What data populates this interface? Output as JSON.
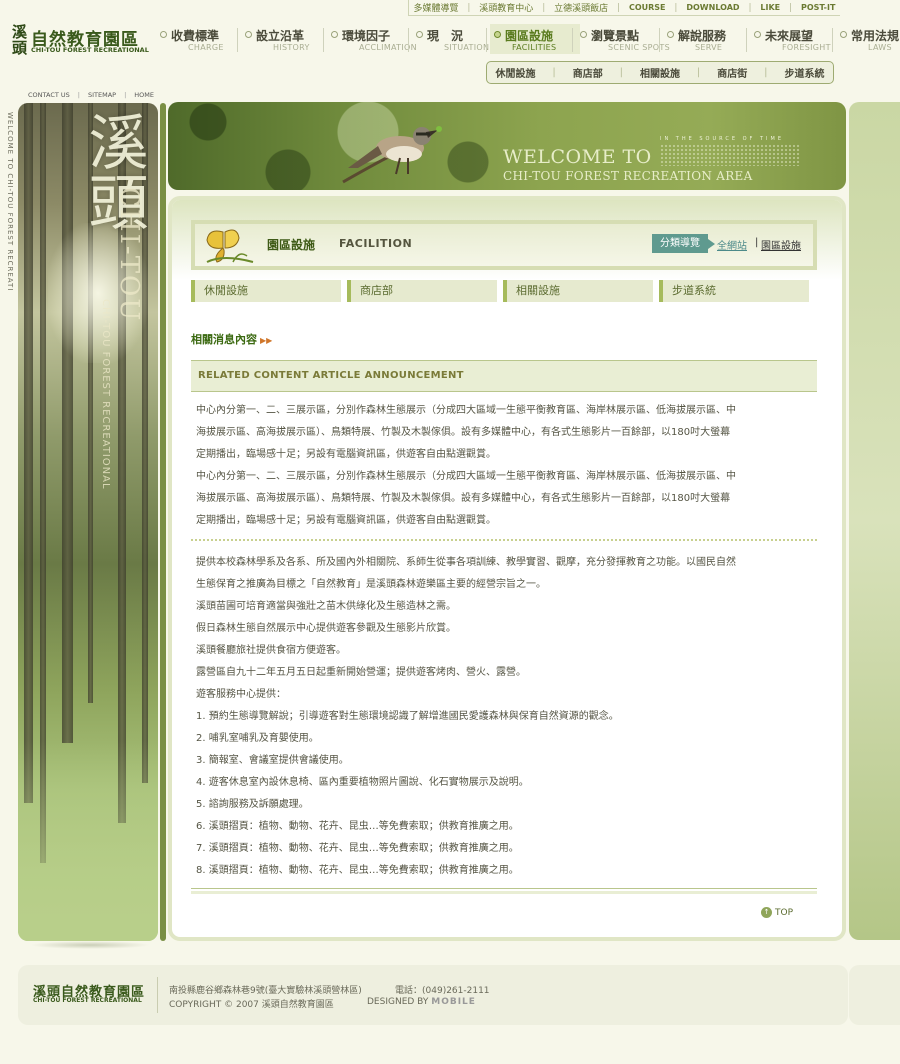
{
  "topbar": {
    "links": [
      "多媒體導覽",
      "溪頭教育中心",
      "立德溪頭飯店",
      "COURSE",
      "DOWNLOAD",
      "LIKE",
      "POST-IT"
    ]
  },
  "logo": {
    "vertical": "溪頭",
    "name": "自然教育園區",
    "sub": "CHI-TOU FOREST RECREATIONAL"
  },
  "nav": [
    {
      "zh": "收費標準",
      "en": "CHARGE"
    },
    {
      "zh": "設立沿革",
      "en": "HISTORY"
    },
    {
      "zh": "環境因子",
      "en": "ACCLIMATION"
    },
    {
      "zh": "現　況",
      "en": "SITUATION"
    },
    {
      "zh": "園區設施",
      "en": "FACILITIES"
    },
    {
      "zh": "瀏覽景點",
      "en": "SCENIC SPOTS"
    },
    {
      "zh": "解說服務",
      "en": "SERVE"
    },
    {
      "zh": "未來展望",
      "en": "FORESIGHT"
    },
    {
      "zh": "常用法規",
      "en": "LAWS"
    }
  ],
  "subnav": [
    "休閒設施",
    "商店部",
    "相關設施",
    "商店街",
    "步道系統"
  ],
  "small_links": [
    "CONTACT US",
    "SITEMAP",
    "HOME"
  ],
  "vertical_welcome": "WELCOME TO CHI-TOU FOREST RECREATI",
  "left_panel": {
    "big_text": "溪頭",
    "vertical_en": "CHI-TOU",
    "vertical_en2": "CHI-TOU FOREST RECREATIONAL"
  },
  "banner": {
    "welcome_line1": "WELCOME TO",
    "welcome_line2": "CHI-TOU FOREST RECREATION AREA",
    "tiny": "IN THE SOURCE OF TIME"
  },
  "crumb": {
    "title_zh": "園區設施",
    "title_en": "FACILITION",
    "pill": "分類導覽",
    "link_all": "全網站",
    "link_current": "園區設施"
  },
  "tabs": [
    "休閒設施",
    "商店部",
    "相關設施",
    "步道系統"
  ],
  "section_title": "相關消息內容",
  "announcement": "RELATED CONTENT ARTICLE ANNOUNCEMENT",
  "paragraph1": [
    "中心內分第一、二、三展示區，分別作森林生態展示（分成四大區域一生態平衡教育區、海岸林展示區、低海拔展示區、中",
    "海拔展示區、高海拔展示區）、鳥類特展、竹製及木製傢俱。設有多媒體中心，有各式生態影片一百餘部，以180吋大螢幕",
    "定期播出，臨場感十足；另設有電腦資訊區，供遊客自由點選觀賞。",
    "中心內分第一、二、三展示區，分別作森林生態展示（分成四大區域一生態平衡教育區、海岸林展示區、低海拔展示區、中",
    "海拔展示區、高海拔展示區）、鳥類特展、竹製及木製傢俱。設有多媒體中心，有各式生態影片一百餘部，以180吋大螢幕",
    "定期播出，臨場感十足；另設有電腦資訊區，供遊客自由點選觀賞。"
  ],
  "paragraph2": [
    "提供本校森林學系及各系、所及國內外相關院、系師生從事各項訓練、教學實習、觀摩，充分發揮教育之功能。以國民自然",
    "生態保育之推廣為目標之「自然教育」是溪頭森林遊樂區主要的經營宗旨之一。",
    "溪頭苗圃可培育適當與強壯之苗木供綠化及生態造林之需。",
    "假日森林生態自然展示中心提供遊客參觀及生態影片欣賞。",
    "溪頭餐廳旅社提供食宿方便遊客。",
    "露營區自九十二年五月五日起重新開始營運；提供遊客烤肉、營火、露營。",
    "遊客服務中心提供：",
    "1. 預約生態導覽解說；引導遊客對生態環境認識了解增進國民愛護森林與保育自然資源的觀念。",
    "2. 哺乳室哺乳及育嬰使用。",
    "3. 簡報室、會議室提供會議使用。",
    "4. 遊客休息室內設休息椅、區內重要植物照片圖說、化石實物展示及說明。",
    "5. 諮詢服務及訴願處理。",
    "6. 溪頭摺頁：植物、動物、花卉、昆虫…等免費索取；供教育推廣之用。",
    "7. 溪頭摺頁：植物、動物、花卉、昆虫…等免費索取；供教育推廣之用。",
    "8. 溪頭摺頁：植物、動物、花卉、昆虫…等免費索取；供教育推廣之用。"
  ],
  "top_link": "TOP",
  "footer": {
    "logo_zh": "溪頭自然教育園區",
    "logo_en": "CHI-TOU FOREST RECREATIONAL",
    "address": "南投縣鹿谷鄉森林巷9號(臺大實驗林溪頭營林區)",
    "phone": "電話：(049)261-2111",
    "copyright": "COPYRIGHT © 2007 溪頭自然教育園區",
    "designed_label": "DESIGNED BY",
    "designed_brand": "MOBILE"
  }
}
